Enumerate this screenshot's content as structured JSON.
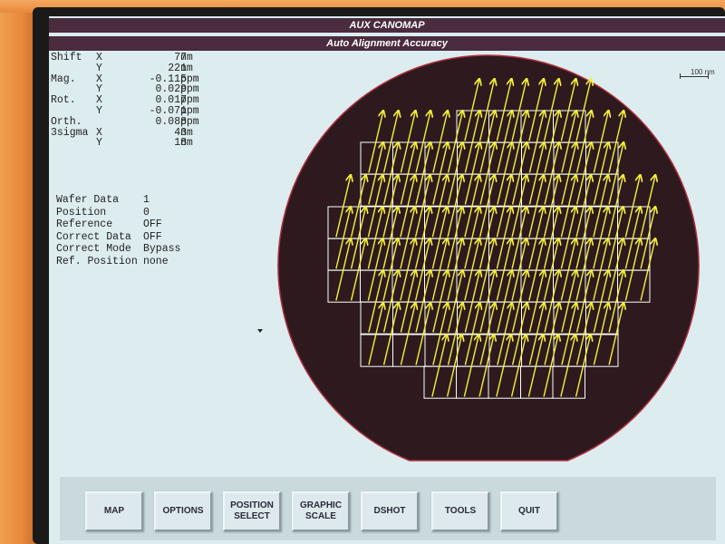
{
  "window": {
    "title": "AUX CANOMAP",
    "subtitle": "Auto Alignment Accuracy"
  },
  "stats": [
    {
      "label": "Shift",
      "axis": "X",
      "value": "77",
      "unit": "nm"
    },
    {
      "label": "",
      "axis": "Y",
      "value": "221",
      "unit": "nm"
    },
    {
      "label": "Mag.",
      "axis": "X",
      "value": "-0.115",
      "unit": "ppm"
    },
    {
      "label": "",
      "axis": "Y",
      "value": "0.029",
      "unit": "ppm"
    },
    {
      "label": "Rot.",
      "axis": "X",
      "value": "0.017",
      "unit": "ppm"
    },
    {
      "label": "",
      "axis": "Y",
      "value": "-0.071",
      "unit": "ppm"
    },
    {
      "label": "Orth.",
      "axis": "",
      "value": "0.088",
      "unit": "ppm"
    },
    {
      "label": "3sigma",
      "axis": "X",
      "value": "43",
      "unit": "nm"
    },
    {
      "label": "",
      "axis": "Y",
      "value": "18",
      "unit": "nm"
    }
  ],
  "info": [
    {
      "label": "Wafer Data",
      "value": "1"
    },
    {
      "label": "Position",
      "value": "0"
    },
    {
      "label": "Reference",
      "value": "OFF"
    },
    {
      "label": "Correct Data",
      "value": "OFF"
    },
    {
      "label": "Correct Mode",
      "value": "Bypass"
    },
    {
      "label": "Ref. Position",
      "value": "none"
    }
  ],
  "scale": {
    "label": "100 nm"
  },
  "colors": {
    "wafer": "#2e1a1e",
    "grid": "#ffffff",
    "vector": "#f2f23a",
    "title_bar": "#4a2c3e"
  },
  "buttons": [
    {
      "id": "map",
      "label": "MAP"
    },
    {
      "id": "options",
      "label": "OPTIONS"
    },
    {
      "id": "position-select",
      "label": "POSITION\nSELECT"
    },
    {
      "id": "graphic-scale",
      "label": "GRAPHIC\nSCALE"
    },
    {
      "id": "dshot",
      "label": "DSHOT"
    },
    {
      "id": "tools",
      "label": "TOOLS"
    },
    {
      "id": "quit",
      "label": "QUIT"
    }
  ]
}
